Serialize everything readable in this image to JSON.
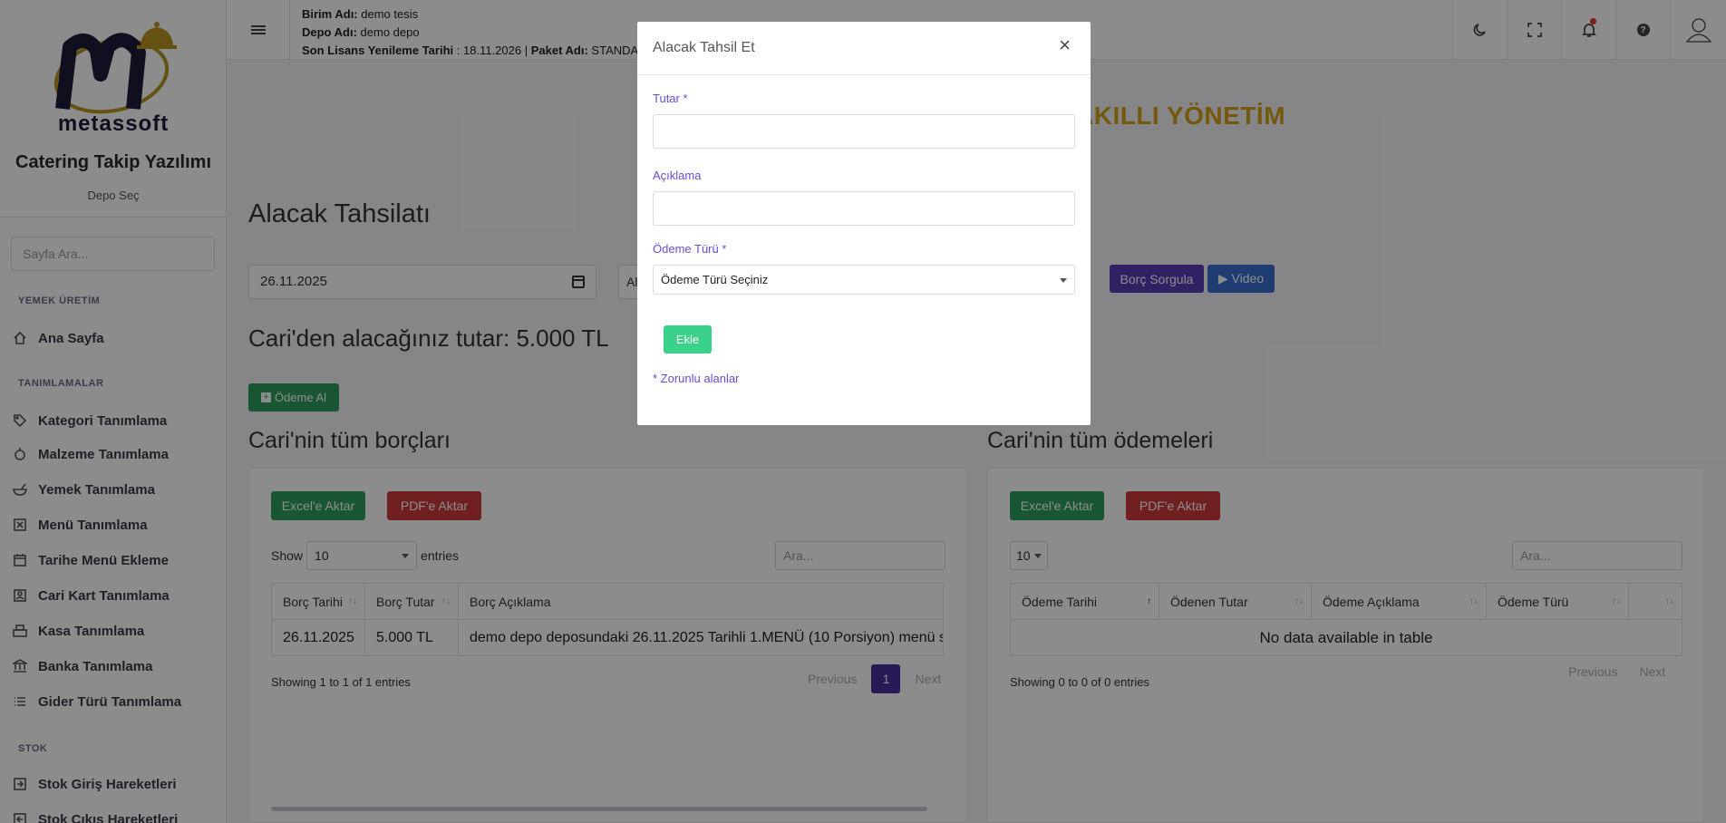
{
  "sidebar": {
    "logo_text": "metassoft",
    "app_name": "Catering Takip Yazılımı",
    "depo_sec": "Depo Seç",
    "search_placeholder": "Sayfa Ara...",
    "sections": [
      "YEMEK ÜRETİM",
      "TANIMLAMALAR",
      "STOK"
    ],
    "items": [
      {
        "label": "Ana Sayfa",
        "icon": "home-icon"
      },
      {
        "label": "Kategori Tanımlama",
        "icon": "tag-icon"
      },
      {
        "label": "Malzeme Tanımlama",
        "icon": "ingredient-icon"
      },
      {
        "label": "Yemek Tanımlama",
        "icon": "bowl-icon"
      },
      {
        "label": "Menü Tanımlama",
        "icon": "menu-icon"
      },
      {
        "label": "Tarihe Menü Ekleme",
        "icon": "calendar-icon"
      },
      {
        "label": "Cari Kart Tanımlama",
        "icon": "contact-card-icon"
      },
      {
        "label": "Kasa Tanımlama",
        "icon": "cash-register-icon"
      },
      {
        "label": "Banka Tanımlama",
        "icon": "bank-icon"
      },
      {
        "label": "Gider Türü Tanımlama",
        "icon": "list-icon"
      },
      {
        "label": "Stok Giriş Hareketleri",
        "icon": "stock-in-icon"
      },
      {
        "label": "Stok Çıkış Hareketleri",
        "icon": "stock-out-icon"
      }
    ]
  },
  "header": {
    "birim_label": "Birim Adı:",
    "birim_value": "demo tesis",
    "depo_label": "Depo Adı:",
    "depo_value": "demo depo",
    "lisans_label": "Son Lisans Yenileme Tarihi",
    "lisans_value": ": 18.11.2026 |",
    "paket_label": "Paket Adı:",
    "paket_value": "STANDA"
  },
  "main": {
    "banner": "AKILLI YÖNETİM",
    "title": "Alacak Tahsilatı",
    "date_value": "26.11.2025",
    "select_stub": "Al",
    "borc_sorgula": "Borç Sorgula",
    "video": "▶ Video",
    "amount_text": "Cari'den alacağınız tutar: 5.000 TL",
    "odeme_al": "Ödeme Al"
  },
  "borclar": {
    "title": "Cari'nin tüm borçları",
    "excel": "Excel'e Aktar",
    "pdf": "PDF'e Aktar",
    "show": "Show",
    "entries": "entries",
    "page_size": "10",
    "search_placeholder": "Ara...",
    "columns": [
      "Borç Tarihi",
      "Borç Tutar",
      "Borç Açıklama"
    ],
    "rows": [
      [
        "26.11.2025",
        "5.000 TL",
        "demo depo deposundaki 26.11.2025 Tarihli 1.MENÜ (10 Porsiyon) menü s"
      ]
    ],
    "showing": "Showing 1 to 1 of 1 entries",
    "previous": "Previous",
    "page": "1",
    "next": "Next"
  },
  "odemeler": {
    "title": "Cari'nin tüm ödemeleri",
    "excel": "Excel'e Aktar",
    "pdf": "PDF'e Aktar",
    "page_size": "10",
    "search_placeholder": "Ara...",
    "columns": [
      "Ödeme Tarihi",
      "Ödenen Tutar",
      "Ödeme Açıklama",
      "Ödeme Türü",
      ""
    ],
    "empty": "No data available in table",
    "showing": "Showing 0 to 0 of 0 entries",
    "previous": "Previous",
    "next": "Next"
  },
  "modal": {
    "title": "Alacak Tahsil Et",
    "close": "×",
    "tutar_label": "Tutar *",
    "tutar_value": "",
    "aciklama_label": "Açıklama",
    "aciklama_value": "",
    "odeme_turu_label": "Ödeme Türü *",
    "odeme_turu_value": "Ödeme Türü Seçiniz",
    "submit": "Ekle",
    "required_note": "* Zorunlu alanlar"
  },
  "colors": {
    "accent_purple": "#5a3db6",
    "label_purple": "#6a4bd0",
    "green": "#2e9e5f",
    "red": "#cc3b3b",
    "gold": "#d4a017"
  }
}
